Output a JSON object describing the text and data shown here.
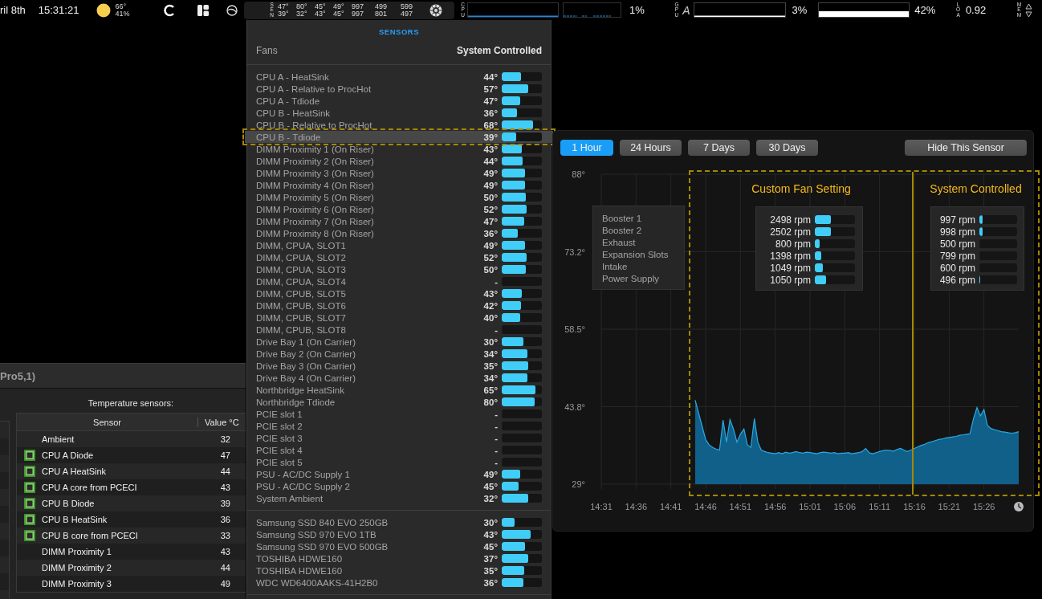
{
  "menu_bar": {
    "date": "ril 8th",
    "time": "15:31:21",
    "weather": {
      "temperature": "66°",
      "humidity": "41%"
    },
    "sensor_strip": {
      "label": "SEN",
      "rows": [
        [
          "47°",
          "80°",
          "45°",
          "49°",
          "997",
          "499",
          "599"
        ],
        [
          "39°",
          "32°",
          "43°",
          "45°",
          "997",
          "801",
          "497"
        ]
      ]
    },
    "cpu": {
      "label": "CPU",
      "reading": "1%"
    },
    "gpu": {
      "label": "GPU",
      "glyph": "A",
      "reading": "3%",
      "second_reading": "42%"
    },
    "load": {
      "label": "LOA",
      "reading": "0.92"
    },
    "memory": {
      "label": "MEM"
    }
  },
  "sensors_popover": {
    "title": "SENSORS",
    "fans_label": "Fans",
    "fans_mode": "System Controlled",
    "groups": [
      {
        "rows": [
          {
            "name": "CPU A - HeatSink",
            "value": "44°",
            "level": 0.48,
            "selected": false
          },
          {
            "name": "CPU A - Relative to ProcHot",
            "value": "57°",
            "level": 0.66,
            "selected": false
          },
          {
            "name": "CPU A - Tdiode",
            "value": "47°",
            "level": 0.46,
            "selected": false
          },
          {
            "name": "CPU B - HeatSink",
            "value": "36°",
            "level": 0.38,
            "selected": false
          },
          {
            "name": "CPU B - Relative to ProcHot",
            "value": "68°",
            "level": 0.78,
            "selected": false
          },
          {
            "name": "CPU B - Tdiode",
            "value": "39°",
            "level": 0.36,
            "selected": true
          },
          {
            "name": "DIMM Proximity 1 (On Riser)",
            "value": "43°",
            "level": 0.5,
            "selected": false
          },
          {
            "name": "DIMM Proximity 2 (On Riser)",
            "value": "44°",
            "level": 0.52,
            "selected": false
          },
          {
            "name": "DIMM Proximity 3 (On Riser)",
            "value": "49°",
            "level": 0.58,
            "selected": false
          },
          {
            "name": "DIMM Proximity 4 (On Riser)",
            "value": "49°",
            "level": 0.58,
            "selected": false
          },
          {
            "name": "DIMM Proximity 5 (On Riser)",
            "value": "50°",
            "level": 0.6,
            "selected": false
          },
          {
            "name": "DIMM Proximity 6 (On Riser)",
            "value": "52°",
            "level": 0.62,
            "selected": false
          },
          {
            "name": "DIMM Proximity 7 (On Riser)",
            "value": "47°",
            "level": 0.56,
            "selected": false
          },
          {
            "name": "DIMM Proximity 8 (On Riser)",
            "value": "36°",
            "level": 0.4,
            "selected": false
          },
          {
            "name": "DIMM, CPUA, SLOT1",
            "value": "49°",
            "level": 0.58,
            "selected": false
          },
          {
            "name": "DIMM, CPUA, SLOT2",
            "value": "52°",
            "level": 0.62,
            "selected": false
          },
          {
            "name": "DIMM, CPUA, SLOT3",
            "value": "50°",
            "level": 0.6,
            "selected": false
          },
          {
            "name": "DIMM, CPUA, SLOT4",
            "value": "-",
            "level": 0,
            "selected": false
          },
          {
            "name": "DIMM, CPUB, SLOT5",
            "value": "43°",
            "level": 0.5,
            "selected": false
          },
          {
            "name": "DIMM, CPUB, SLOT6",
            "value": "42°",
            "level": 0.48,
            "selected": false
          },
          {
            "name": "DIMM, CPUB, SLOT7",
            "value": "40°",
            "level": 0.46,
            "selected": false
          },
          {
            "name": "DIMM, CPUB, SLOT8",
            "value": "-",
            "level": 0,
            "selected": false
          },
          {
            "name": "Drive Bay 1 (On Carrier)",
            "value": "30°",
            "level": 0.54,
            "selected": false
          },
          {
            "name": "Drive Bay 2 (On Carrier)",
            "value": "34°",
            "level": 0.64,
            "selected": false
          },
          {
            "name": "Drive Bay 3 (On Carrier)",
            "value": "35°",
            "level": 0.66,
            "selected": false
          },
          {
            "name": "Drive Bay 4 (On Carrier)",
            "value": "34°",
            "level": 0.64,
            "selected": false
          },
          {
            "name": "Northbridge HeatSink",
            "value": "65°",
            "level": 0.84,
            "selected": false
          },
          {
            "name": "Northbridge Tdiode",
            "value": "80°",
            "level": 0.82,
            "selected": false
          },
          {
            "name": "PCIE slot 1",
            "value": "-",
            "level": 0,
            "selected": false
          },
          {
            "name": "PCIE slot 2",
            "value": "-",
            "level": 0,
            "selected": false
          },
          {
            "name": "PCIE slot 3",
            "value": "-",
            "level": 0,
            "selected": false
          },
          {
            "name": "PCIE slot 4",
            "value": "-",
            "level": 0,
            "selected": false
          },
          {
            "name": "PCIE slot 5",
            "value": "-",
            "level": 0,
            "selected": false
          },
          {
            "name": "PSU - AC/DC Supply 1",
            "value": "49°",
            "level": 0.46,
            "selected": false
          },
          {
            "name": "PSU - AC/DC Supply 2",
            "value": "45°",
            "level": 0.42,
            "selected": false
          },
          {
            "name": "System Ambient",
            "value": "32°",
            "level": 0.66,
            "selected": false
          }
        ]
      },
      {
        "rows": [
          {
            "name": "Samsung SSD 840 EVO 250GB",
            "value": "30°",
            "level": 0.32,
            "selected": false
          },
          {
            "name": "Samsung SSD 970 EVO 1TB",
            "value": "43°",
            "level": 0.72,
            "selected": false
          },
          {
            "name": "Samsung SSD 970 EVO 500GB",
            "value": "45°",
            "level": 0.58,
            "selected": false
          },
          {
            "name": "TOSHIBA HDWE160",
            "value": "37°",
            "level": 0.66,
            "selected": false
          },
          {
            "name": "TOSHIBA HDWE160",
            "value": "35°",
            "level": 0.56,
            "selected": false
          },
          {
            "name": "WDC WD6400AAKS-41H2B0",
            "value": "36°",
            "level": 0.54,
            "selected": false
          }
        ]
      }
    ]
  },
  "history_panel": {
    "ranges": [
      {
        "label": "1 Hour",
        "selected": true
      },
      {
        "label": "24 Hours",
        "selected": false
      },
      {
        "label": "7 Days",
        "selected": false
      },
      {
        "label": "30 Days",
        "selected": false
      }
    ],
    "hide_button": "Hide This Sensor",
    "chart_data": {
      "type": "area",
      "grid": true,
      "ylim": [
        29,
        88
      ],
      "categories": [
        "14:31",
        null,
        null,
        null,
        null,
        null,
        null,
        null,
        null,
        null,
        "14:36",
        null,
        null,
        null,
        null,
        null,
        null,
        null,
        null,
        null,
        "14:41",
        null,
        null,
        null,
        null,
        null,
        null,
        null,
        null,
        null,
        "14:46",
        null,
        null,
        null,
        null,
        null,
        null,
        null,
        null,
        null,
        "14:51",
        null,
        null,
        null,
        null,
        null,
        null,
        null,
        null,
        null,
        "14:56",
        null,
        null,
        null,
        null,
        null,
        null,
        null,
        null,
        null,
        "15:01",
        null,
        null,
        null,
        null,
        null,
        null,
        null,
        null,
        null,
        "15:06",
        null,
        null,
        null,
        null,
        null,
        null,
        null,
        null,
        null,
        "15:11",
        null,
        null,
        null,
        null,
        null,
        null,
        null,
        null,
        null,
        "15:16",
        null,
        null,
        null,
        null,
        null,
        null,
        null,
        null,
        null,
        "15:21",
        null,
        null,
        null,
        null,
        null,
        null,
        null,
        null,
        null,
        "15:26",
        null,
        null,
        null,
        null,
        null,
        null,
        null,
        null,
        null,
        null
      ],
      "yticks": [
        {
          "value": 88,
          "label": "88°"
        },
        {
          "value": 73.25,
          "label": "73.2°"
        },
        {
          "value": 58.5,
          "label": "58.5°"
        },
        {
          "value": 43.75,
          "label": "43.8°"
        },
        {
          "value": 29,
          "label": "29°"
        }
      ],
      "values": [
        null,
        null,
        null,
        null,
        null,
        null,
        null,
        null,
        null,
        null,
        null,
        null,
        null,
        null,
        null,
        null,
        null,
        null,
        null,
        null,
        null,
        null,
        null,
        null,
        null,
        null,
        null,
        45,
        42.5,
        40,
        37.5,
        36.5,
        36,
        35.7,
        35.5,
        41.2,
        37,
        41.3,
        39.5,
        37,
        38.5,
        39.5,
        36.5,
        36,
        41.5,
        37,
        35.5,
        35.2,
        35,
        34.9,
        34.8,
        35,
        34.8,
        35.1,
        34.9,
        35,
        35.2,
        35,
        34.9,
        35.1,
        35,
        34.9,
        34.8,
        35,
        35.1,
        35,
        34.9,
        35,
        34.8,
        34.9,
        34.9,
        35,
        34.8,
        34.9,
        35,
        35.2,
        35.8,
        35,
        34.8,
        35,
        35.2,
        35.4,
        35.5,
        35.4,
        35.3,
        35.6,
        35.8,
        35.5,
        35.2,
        35.5,
        35.8,
        36.1,
        36.4,
        36.6,
        36.9,
        37.1,
        37.3,
        37.5,
        37.6,
        37.8,
        37.9,
        38,
        38.1,
        38.3,
        38.4,
        38.5,
        38.6,
        41.5,
        43.6,
        42,
        43.2,
        40.2,
        39.6,
        39.4,
        39.2,
        39,
        38.9,
        38.8,
        38.7,
        38.8,
        39
      ]
    },
    "legend": [
      "Booster 1",
      "Booster 2",
      "Exhaust",
      "Expansion Slots",
      "Intake",
      "Power Supply"
    ],
    "annotations": [
      {
        "title": "Custom Fan Setting",
        "fans": [
          {
            "reading": "2498 rpm",
            "level": 0.4
          },
          {
            "reading": "2502 rpm",
            "level": 0.4
          },
          {
            "reading": "800 rpm",
            "level": 0.12
          },
          {
            "reading": "1398 rpm",
            "level": 0.16
          },
          {
            "reading": "1049 rpm",
            "level": 0.2
          },
          {
            "reading": "1050 rpm",
            "level": 0.27
          }
        ]
      },
      {
        "title": "System Controlled",
        "fans": [
          {
            "reading": "997 rpm",
            "level": 0.08
          },
          {
            "reading": "998 rpm",
            "level": 0.08
          },
          {
            "reading": "500 rpm",
            "level": 0
          },
          {
            "reading": "799 rpm",
            "level": 0
          },
          {
            "reading": "600 rpm",
            "level": 0
          },
          {
            "reading": "496 rpm",
            "level": 0.03
          }
        ]
      }
    ]
  },
  "app_window": {
    "title": "Pro5,1)",
    "section_title": "Temperature sensors:",
    "columns": [
      "Sensor",
      "Value °C"
    ],
    "rows": [
      {
        "chip": false,
        "sensor": "Ambient",
        "value": "32"
      },
      {
        "chip": true,
        "sensor": "CPU A Diode",
        "value": "47"
      },
      {
        "chip": true,
        "sensor": "CPU A HeatSink",
        "value": "44"
      },
      {
        "chip": true,
        "sensor": "CPU A core from PCECI",
        "value": "43"
      },
      {
        "chip": true,
        "sensor": "CPU B Diode",
        "value": "39"
      },
      {
        "chip": true,
        "sensor": "CPU B HeatSink",
        "value": "36"
      },
      {
        "chip": true,
        "sensor": "CPU B core from PCECI",
        "value": "33"
      },
      {
        "chip": false,
        "sensor": "DIMM Proximity 1",
        "value": "43"
      },
      {
        "chip": false,
        "sensor": "DIMM Proximity 2",
        "value": "44"
      },
      {
        "chip": false,
        "sensor": "DIMM Proximity 3",
        "value": "49"
      }
    ]
  }
}
